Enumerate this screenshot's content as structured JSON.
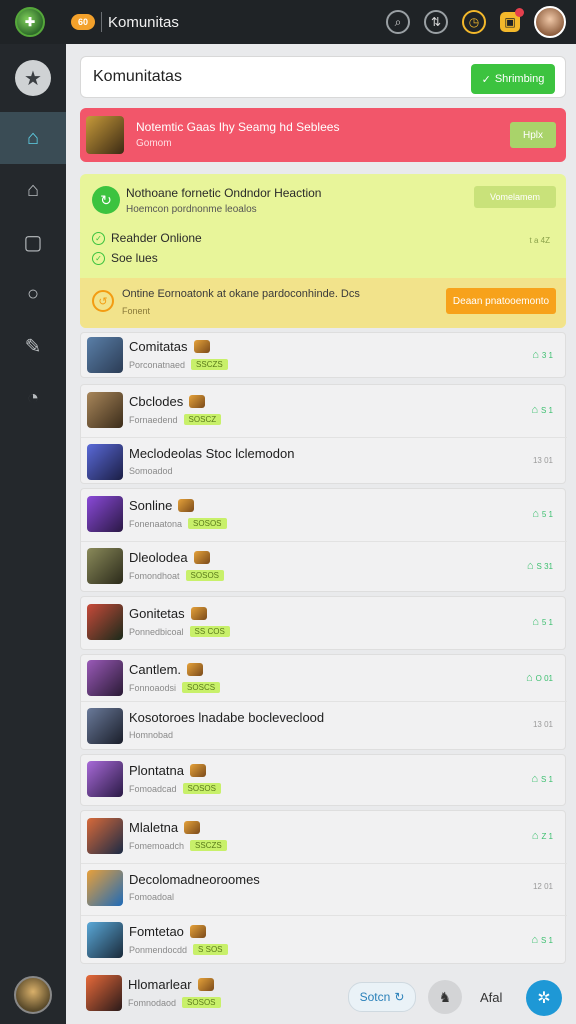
{
  "topbar": {
    "app_title": "Komunitas",
    "badge_label": "60"
  },
  "header": {
    "title": "Komunitatas",
    "create_label": "Shrimbing"
  },
  "banner": {
    "title": "Notemtic Gaas Ihy Seamg hd Seblees",
    "subtitle": "Gomom",
    "action": "Hplx"
  },
  "notification": {
    "title": "Nothoane fornetic Ondndor Heaction",
    "subtitle": "Hoemcon pordnonme leoalos",
    "action": "Vomelamem",
    "items": [
      "Reahder Onlione",
      "Soe lues"
    ],
    "meta": "t a 4Z",
    "inner": {
      "title": "Ontine Eornoatonk at okane pardoconhinde. Dcs",
      "subtitle": "Fonent",
      "action": "Deaan pnatooemonto"
    }
  },
  "rows": [
    {
      "name": "Comitatas",
      "sub": "Porconatnaed",
      "badge": "SSCZS",
      "right": "3 1",
      "right_style": "green",
      "thumb": [
        "#5a7fa8",
        "#2b3c55"
      ]
    },
    {
      "name": "Cbclodes",
      "sub": "Fornaedend",
      "badge": "SOSCZ",
      "right": "S 1",
      "right_style": "green",
      "thumb": [
        "#a8865a",
        "#3b2c1a"
      ]
    },
    {
      "name": "Meclodeolas Stoc lclemodon",
      "sub": "Somoadod",
      "badge": "",
      "right": "13 01",
      "right_style": "gray",
      "thumb": [
        "#5a6ad8",
        "#1b1e45"
      ]
    },
    {
      "name": "Sonline",
      "sub": "Fonenaatona",
      "badge": "SOSOS",
      "right": "5 1",
      "right_style": "green",
      "thumb": [
        "#8a4ad8",
        "#2a1845"
      ]
    },
    {
      "name": "Dleolodea",
      "sub": "Fomondhoat",
      "badge": "SOSOS",
      "right": "S 31",
      "right_style": "green",
      "thumb": [
        "#8a8a5a",
        "#2b2a1a"
      ]
    },
    {
      "name": "Gonitetas",
      "sub": "Ponnedbicoal",
      "badge": "SS COS",
      "right": "5 1",
      "right_style": "green",
      "thumb": [
        "#c84a3a",
        "#1a2a1a"
      ]
    },
    {
      "name": "Cantlem.",
      "sub": "Fonnoaodsi",
      "badge": "SOSCS",
      "right": "O 01",
      "right_style": "green",
      "thumb": [
        "#9a5ab8",
        "#2a1a35"
      ]
    },
    {
      "name": "Kosotoroes lnadabe bocleveclood",
      "sub": "Homnobad",
      "badge": "",
      "right": "13 01",
      "right_style": "gray",
      "thumb": [
        "#6a7a9a",
        "#1a1e2a"
      ]
    },
    {
      "name": "Plontatna",
      "sub": "Fomoadcad",
      "badge": "SOSOS",
      "right": "S 1",
      "right_style": "green",
      "thumb": [
        "#a86ad8",
        "#2a1a45"
      ]
    },
    {
      "name": "Mlaletna",
      "sub": "Fomemoadch",
      "badge": "SSCZS",
      "right": "Z 1",
      "right_style": "green",
      "thumb": [
        "#d86a3a",
        "#1b2a45"
      ]
    },
    {
      "name": "Decolomadneoroomes",
      "sub": "Fomoadoal",
      "badge": "",
      "right": "12 01",
      "right_style": "gray",
      "thumb": [
        "#e8a03a",
        "#1e6ab8"
      ]
    },
    {
      "name": "Fomtetao",
      "sub": "Ponmendocdd",
      "badge": "S SOS",
      "right": "S 1",
      "right_style": "green",
      "thumb": [
        "#5aa8d8",
        "#1a2a3a"
      ]
    },
    {
      "name": "Hlomarlear",
      "sub": "Fomnodaod",
      "badge": "SOSOS",
      "right": "",
      "right_style": "none",
      "thumb": [
        "#e86a3a",
        "#2a1a1a"
      ]
    }
  ],
  "bottom": {
    "button_label": "Sotcn",
    "text": "Afal"
  },
  "colors": {
    "accent_green": "#3cc33f",
    "banner_red": "#f2566a",
    "notif_bg": "#e8f59a",
    "orange": "#f7a21b",
    "fab_blue": "#1e98d6"
  }
}
